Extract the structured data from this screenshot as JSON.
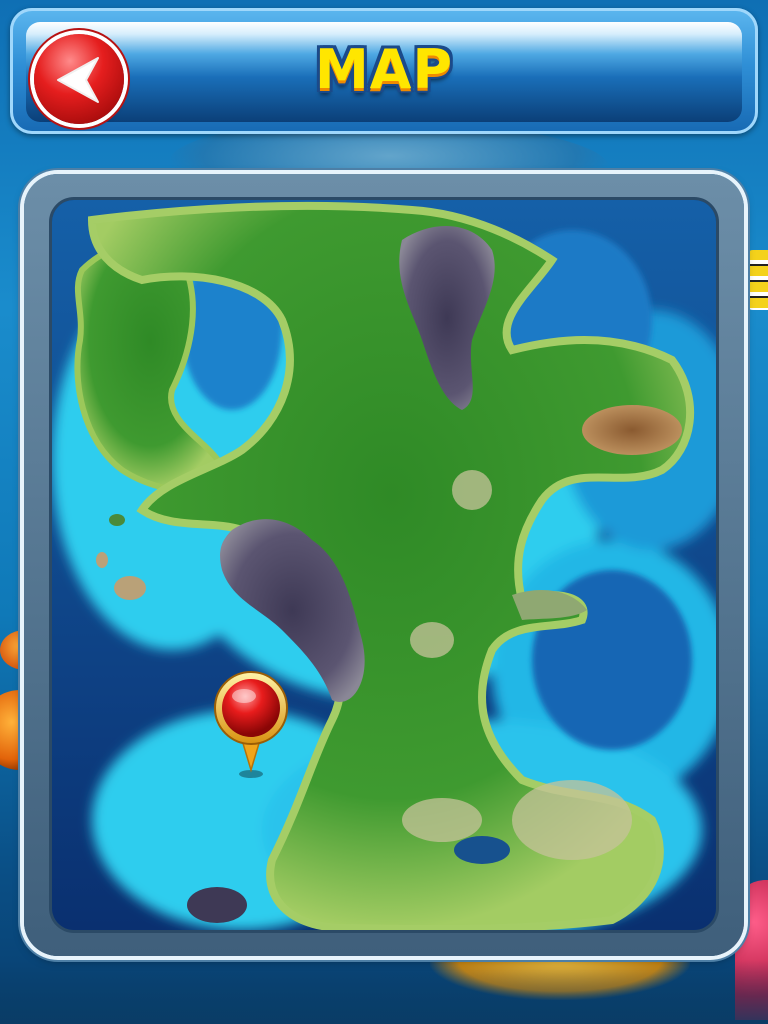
{
  "header": {
    "title": "MAP",
    "back_icon": "back-arrow-icon",
    "back_button_color": "#e51e1e",
    "title_color": "#ffe600"
  },
  "map": {
    "pin_icon": "location-pin-icon",
    "pin_color": "#e01818",
    "regions": [
      "island-west",
      "island-north-mountains",
      "mainland",
      "peninsula-east",
      "south-lands",
      "small-isles"
    ]
  },
  "colors": {
    "ocean_deep": "#0b3a7a",
    "ocean_shallow": "#2fd0ef",
    "land_dark": "#1f6b1e",
    "land_light": "#9bc85a",
    "mountain": "#4a4560"
  }
}
